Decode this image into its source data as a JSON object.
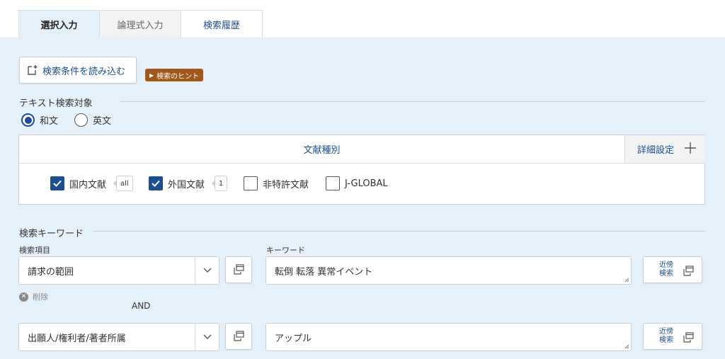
{
  "tabs": [
    {
      "label": "選択入力"
    },
    {
      "label": "論理式入力"
    },
    {
      "label": "検索履歴"
    }
  ],
  "toolbar": {
    "load_label": "検索条件を読み込む",
    "hint_label": "検索のヒント"
  },
  "text_target": {
    "heading": "テキスト検索対象",
    "options": [
      {
        "label": "和文",
        "selected": true
      },
      {
        "label": "英文",
        "selected": false
      }
    ]
  },
  "doc_types": {
    "heading": "文献種別",
    "detail_label": "詳細設定",
    "items": [
      {
        "label": "国内文献",
        "checked": true,
        "badge": "all"
      },
      {
        "label": "外国文献",
        "checked": true,
        "badge": "1"
      },
      {
        "label": "非特許文献",
        "checked": false
      },
      {
        "label": "J-GLOBAL",
        "checked": false
      }
    ]
  },
  "keywords": {
    "heading": "検索キーワード",
    "field_label": "検索項目",
    "keyword_label": "キーワード",
    "rows": [
      {
        "field": "請求の範囲",
        "keyword": "転倒 転落 異常イベント"
      },
      {
        "field": "出願人/権利者/著者所属",
        "keyword": "アップル"
      }
    ],
    "near_label_1": "近傍",
    "near_label_2": "検索",
    "delete_label": "削除",
    "operator": "AND"
  },
  "colors": {
    "accent": "#1d4e8f",
    "panel_bg": "#e6f0f8",
    "hint_badge": "#a0581a"
  }
}
